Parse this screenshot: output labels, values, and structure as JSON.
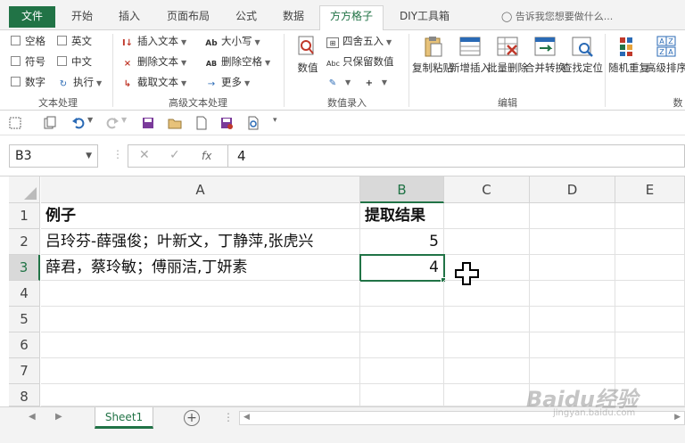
{
  "ribbon_tabs": [
    {
      "label": "文件",
      "state": "file"
    },
    {
      "label": "开始",
      "state": ""
    },
    {
      "label": "插入",
      "state": ""
    },
    {
      "label": "页面布局",
      "state": ""
    },
    {
      "label": "公式",
      "state": ""
    },
    {
      "label": "数据",
      "state": ""
    },
    {
      "label": "方方格子",
      "state": "active"
    },
    {
      "label": "DIY工具箱",
      "state": ""
    }
  ],
  "tell_me": "告诉我您想要做什么...",
  "ribbon": {
    "text_type": {
      "checkboxes": [
        "空格",
        "英文",
        "符号",
        "中文",
        "数字"
      ],
      "execute": "执行",
      "group_label": "文本处理"
    },
    "advanced_text": {
      "insert_text": "插入文本",
      "delete_text": "删除文本",
      "cut_text": "截取文本",
      "case": "大小写",
      "delete_space": "删除空格",
      "more": "更多",
      "group_label": "高级文本处理"
    },
    "numeric_entry": {
      "value": "数值",
      "round": "四舍五入",
      "keep_value": "只保留数值",
      "group_label": "数值录入"
    },
    "edit": {
      "copy_paste": "复制粘贴",
      "insert_new": "新增插入",
      "batch_delete": "批量删除",
      "merge_convert": "合并转换",
      "find_locate": "查找定位",
      "group_label": "编辑"
    },
    "extra": {
      "random_repeat": "随机重复",
      "advanced_sort": "高级排序",
      "group_label": "数"
    }
  },
  "formula_bar": {
    "name_box": "B3",
    "formula": "4",
    "fx": "fx"
  },
  "grid": {
    "columns": [
      "A",
      "B",
      "C",
      "D",
      "E"
    ],
    "rows": [
      "1",
      "2",
      "3",
      "4",
      "5",
      "6",
      "7",
      "8"
    ],
    "cells": {
      "A1": "例子",
      "B1": "提取结果",
      "A2": "吕玲芬-薛强俊；叶新文，丁静萍,张虎兴",
      "B2": "5",
      "A3": "薛君，蔡玲敏；傅丽洁,丁妍素",
      "B3": "4"
    },
    "selected_cell": "B3"
  },
  "sheet_tabs": [
    "Sheet1"
  ],
  "watermark": {
    "main": "Baidu经验",
    "sub": "jingyan.baidu.com"
  },
  "colors": {
    "accent": "#217346"
  }
}
